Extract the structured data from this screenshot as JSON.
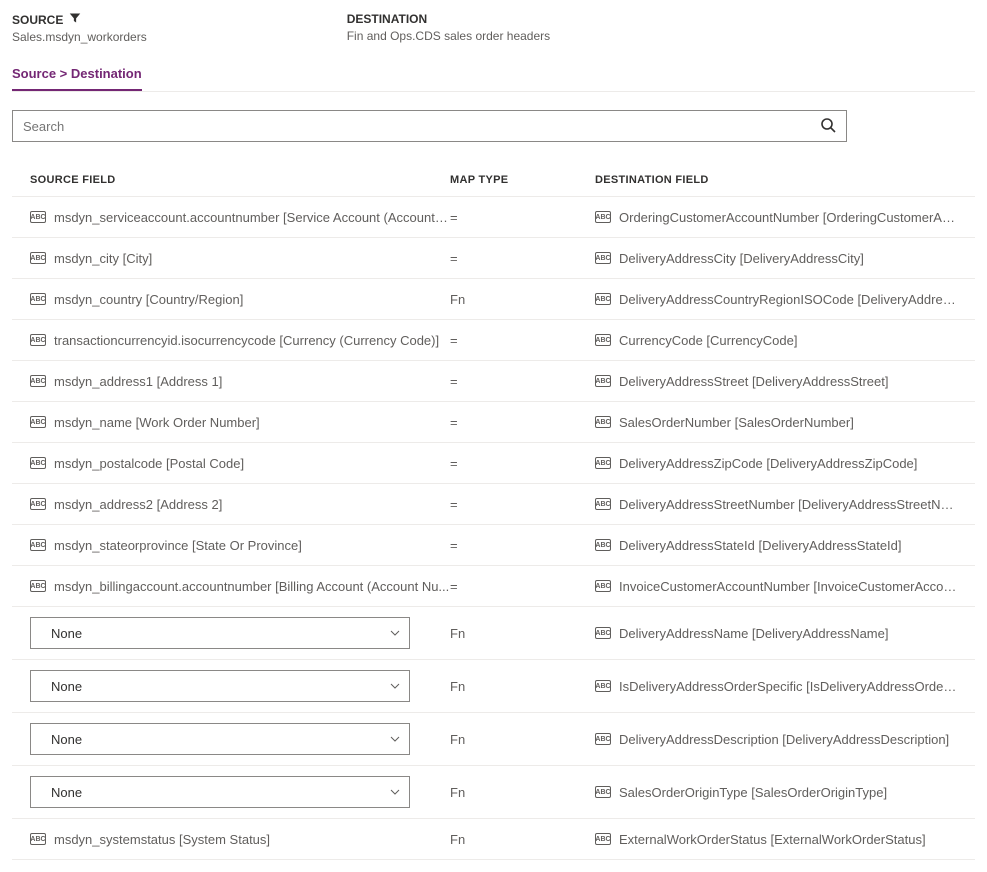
{
  "header": {
    "source_label": "SOURCE",
    "source_value": "Sales.msdyn_workorders",
    "destination_label": "DESTINATION",
    "destination_value": "Fin and Ops.CDS sales order headers"
  },
  "tabs": {
    "active": "Source > Destination"
  },
  "search": {
    "placeholder": "Search"
  },
  "columns": {
    "source": "SOURCE FIELD",
    "map": "MAP TYPE",
    "dest": "DESTINATION FIELD"
  },
  "rows": [
    {
      "source": "msdyn_serviceaccount.accountnumber [Service Account (Account N...",
      "map": "=",
      "dest": "OrderingCustomerAccountNumber [OrderingCustomerAccountNum..."
    },
    {
      "source": "msdyn_city [City]",
      "map": "=",
      "dest": "DeliveryAddressCity [DeliveryAddressCity]"
    },
    {
      "source": "msdyn_country [Country/Region]",
      "map": "Fn",
      "dest": "DeliveryAddressCountryRegionISOCode [DeliveryAddressCountryRe..."
    },
    {
      "source": "transactioncurrencyid.isocurrencycode [Currency (Currency Code)]",
      "map": "=",
      "dest": "CurrencyCode [CurrencyCode]"
    },
    {
      "source": "msdyn_address1 [Address 1]",
      "map": "=",
      "dest": "DeliveryAddressStreet [DeliveryAddressStreet]"
    },
    {
      "source": "msdyn_name [Work Order Number]",
      "map": "=",
      "dest": "SalesOrderNumber [SalesOrderNumber]"
    },
    {
      "source": "msdyn_postalcode [Postal Code]",
      "map": "=",
      "dest": "DeliveryAddressZipCode [DeliveryAddressZipCode]"
    },
    {
      "source": "msdyn_address2 [Address 2]",
      "map": "=",
      "dest": "DeliveryAddressStreetNumber [DeliveryAddressStreetNumber]"
    },
    {
      "source": "msdyn_stateorprovince [State Or Province]",
      "map": "=",
      "dest": "DeliveryAddressStateId [DeliveryAddressStateId]"
    },
    {
      "source": "msdyn_billingaccount.accountnumber [Billing Account (Account Nu...",
      "map": "=",
      "dest": "InvoiceCustomerAccountNumber [InvoiceCustomerAccountNumber]"
    },
    {
      "dropdown": "None",
      "map": "Fn",
      "dest": "DeliveryAddressName [DeliveryAddressName]"
    },
    {
      "dropdown": "None",
      "map": "Fn",
      "dest": "IsDeliveryAddressOrderSpecific [IsDeliveryAddressOrderSpecific]"
    },
    {
      "dropdown": "None",
      "map": "Fn",
      "dest": "DeliveryAddressDescription [DeliveryAddressDescription]"
    },
    {
      "dropdown": "None",
      "map": "Fn",
      "dest": "SalesOrderOriginType [SalesOrderOriginType]"
    },
    {
      "source": "msdyn_systemstatus [System Status]",
      "map": "Fn",
      "dest": "ExternalWorkOrderStatus [ExternalWorkOrderStatus]"
    }
  ]
}
